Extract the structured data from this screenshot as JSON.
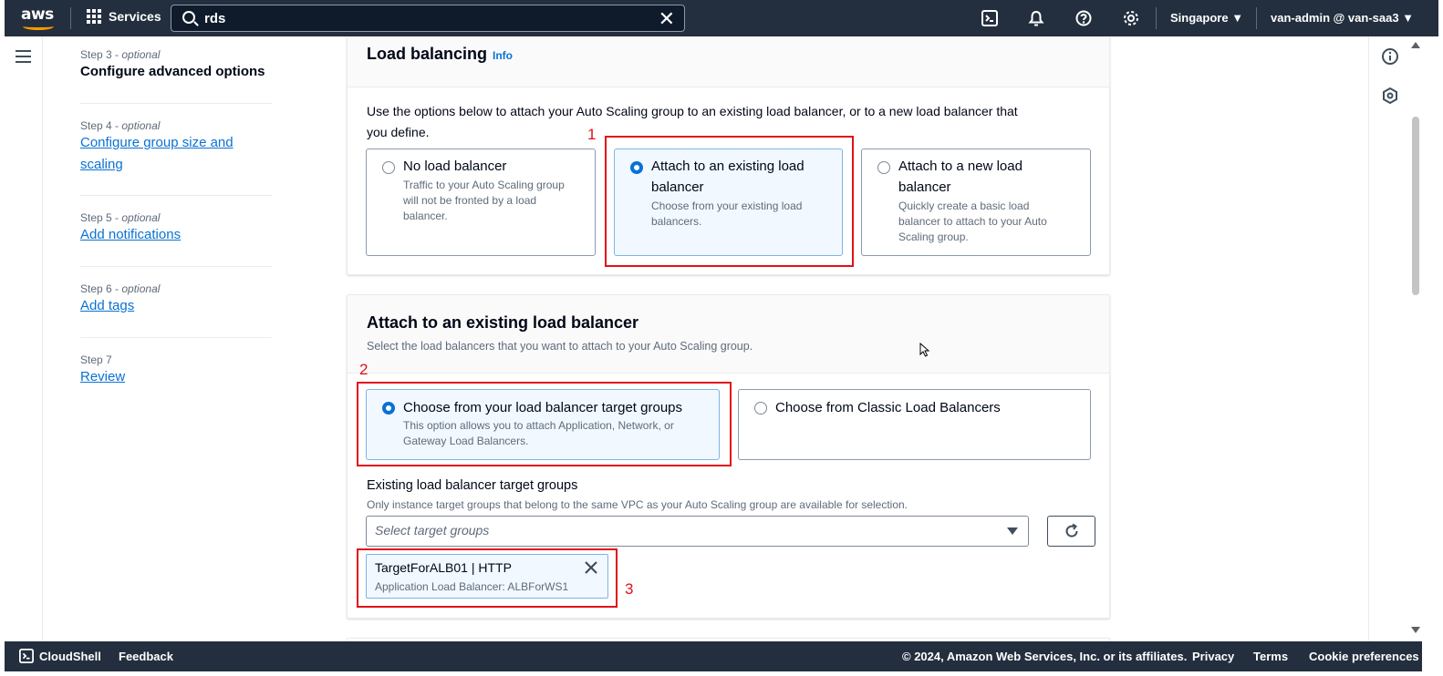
{
  "topbar": {
    "logo_text": "aws",
    "services_label": "Services",
    "search_value": "rds",
    "region": "Singapore",
    "account": "van-admin @ van-saa3"
  },
  "steps": [
    {
      "number": "Step 3",
      "optional": "optional",
      "label": "Configure advanced options",
      "current": true
    },
    {
      "number": "Step 4",
      "optional": "optional",
      "label_line1": "Configure group size and",
      "label_line2": "scaling"
    },
    {
      "number": "Step 5",
      "optional": "optional",
      "label": "Add notifications"
    },
    {
      "number": "Step 6",
      "optional": "optional",
      "label": "Add tags"
    },
    {
      "number": "Step 7",
      "label": "Review"
    }
  ],
  "load_balancing": {
    "title": "Load balancing",
    "info_label": "Info",
    "description_line1": "Use the options below to attach your Auto Scaling group to an existing load balancer, or to a new load balancer that",
    "description_line2": "you define.",
    "options": [
      {
        "title_line1": "No load balancer",
        "desc_line1": "Traffic to your Auto Scaling group",
        "desc_line2": "will not be fronted by a load",
        "desc_line3": "balancer.",
        "selected": false
      },
      {
        "title_line1": "Attach to an existing load",
        "title_line2": "balancer",
        "desc_line1": "Choose from your existing load",
        "desc_line2": "balancers.",
        "selected": true
      },
      {
        "title_line1": "Attach to a new load",
        "title_line2": "balancer",
        "desc_line1": "Quickly create a basic load",
        "desc_line2": "balancer to attach to your Auto",
        "desc_line3": "Scaling group.",
        "selected": false
      }
    ]
  },
  "attach_existing": {
    "title": "Attach to an existing load balancer",
    "subtitle": "Select the load balancers that you want to attach to your Auto Scaling group.",
    "options": [
      {
        "title": "Choose from your load balancer target groups",
        "desc_line1": "This option allows you to attach Application, Network, or",
        "desc_line2": "Gateway Load Balancers.",
        "selected": true
      },
      {
        "title": "Choose from Classic Load Balancers",
        "selected": false
      }
    ],
    "target_groups_label": "Existing load balancer target groups",
    "target_groups_hint": "Only instance target groups that belong to the same VPC as your Auto Scaling group are available for selection.",
    "select_placeholder": "Select target groups",
    "token_title": "TargetForALB01 | HTTP",
    "token_subtitle": "Application Load Balancer: ALBForWS1"
  },
  "annotations": {
    "marker1": "1",
    "marker2": "2",
    "marker3": "3",
    "box_color": "#e0101a"
  },
  "footer": {
    "cloudshell": "CloudShell",
    "feedback": "Feedback",
    "copyright": "© 2024, Amazon Web Services, Inc. or its affiliates.",
    "privacy": "Privacy",
    "terms": "Terms",
    "cookies": "Cookie preferences"
  },
  "colors": {
    "nav_bg": "#232f3e",
    "link": "#0972d3",
    "accent": "#ff9900"
  }
}
